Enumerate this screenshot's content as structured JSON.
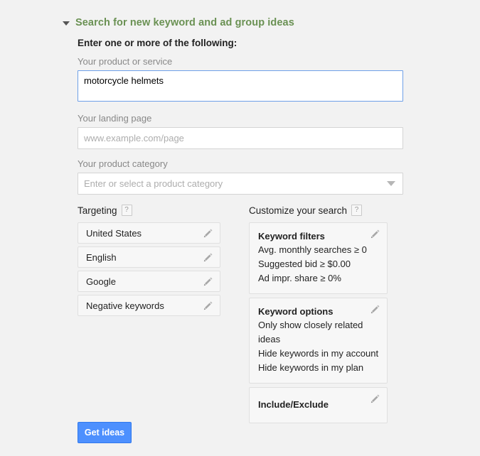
{
  "section": {
    "title": "Search for new keyword and ad group ideas",
    "title_color": "#6a9153",
    "collapse_icon": "triangle-down-icon"
  },
  "form": {
    "heading": "Enter one or more of the following:",
    "product_label": "Your product or service",
    "product_value": "motorcycle helmets",
    "landing_label": "Your landing page",
    "landing_placeholder": "www.example.com/page",
    "landing_value": "",
    "category_label": "Your product category",
    "category_placeholder": "Enter or select a product category",
    "category_value": ""
  },
  "targeting": {
    "heading": "Targeting",
    "help_label": "?",
    "rows": [
      {
        "label": "United States",
        "edit_icon": "pencil-icon"
      },
      {
        "label": "English",
        "edit_icon": "pencil-icon"
      },
      {
        "label": "Google",
        "edit_icon": "pencil-icon"
      },
      {
        "label": "Negative keywords",
        "edit_icon": "pencil-icon"
      }
    ]
  },
  "customize": {
    "heading": "Customize your search",
    "help_label": "?",
    "panels": [
      {
        "title": "Keyword filters",
        "lines": [
          "Avg. monthly searches ≥ 0",
          "Suggested bid ≥ $0.00",
          "Ad impr. share ≥ 0%"
        ]
      },
      {
        "title": "Keyword options",
        "lines": [
          "Only show closely related ideas",
          "Hide keywords in my account",
          "Hide keywords in my plan"
        ]
      },
      {
        "title": "Include/Exclude",
        "lines": []
      }
    ]
  },
  "actions": {
    "get_ideas_label": "Get ideas",
    "get_ideas_color": "#4d90fe"
  }
}
